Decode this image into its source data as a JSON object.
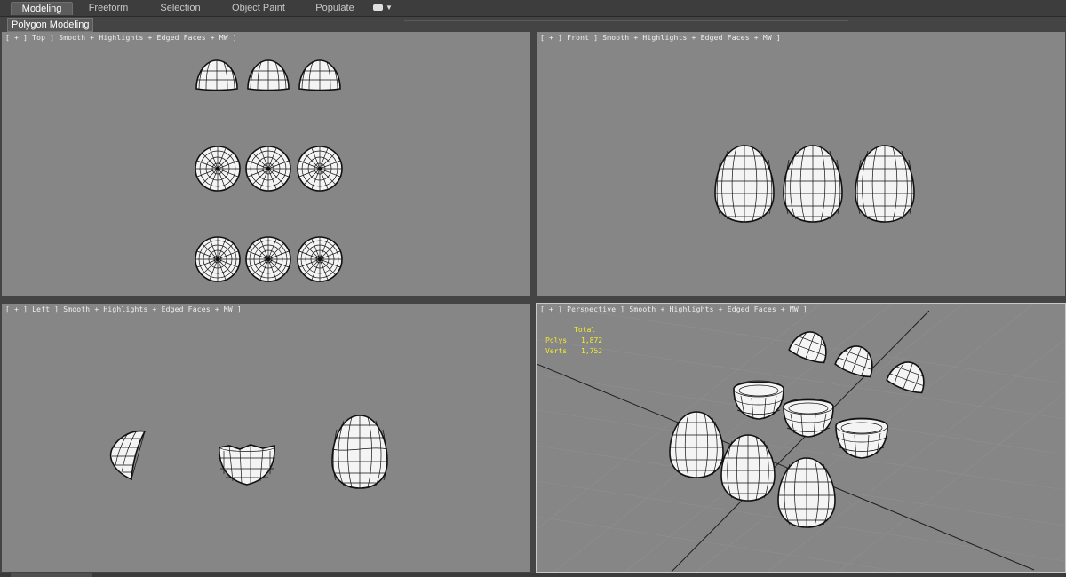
{
  "ribbon": {
    "tabs": [
      {
        "label": "Modeling"
      },
      {
        "label": "Freeform"
      },
      {
        "label": "Selection"
      },
      {
        "label": "Object Paint"
      },
      {
        "label": "Populate"
      }
    ],
    "active_tab": "Modeling",
    "panel_label": "Polygon Modeling"
  },
  "viewports": {
    "top": {
      "label": "[ + ] Top ] Smooth + Highlights + Edged Faces + MW ]"
    },
    "front": {
      "label": "[ + ] Front ] Smooth + Highlights + Edged Faces + MW ]"
    },
    "left": {
      "label": "[ + ] Left ] Smooth + Highlights + Edged Faces + MW ]"
    },
    "perspective": {
      "label": "[ + ] Perspective ] Smooth + Highlights + Edged Faces + MW ]"
    }
  },
  "stats": {
    "heading": "Total",
    "polys_label": "Polys",
    "polys_value": "1,872",
    "verts_label": "Verts",
    "verts_value": "1,752"
  },
  "colors": {
    "viewport_bg": "#868686",
    "stats_text": "#f5ee2a",
    "active_tab_bg": "#5c5c5c"
  }
}
